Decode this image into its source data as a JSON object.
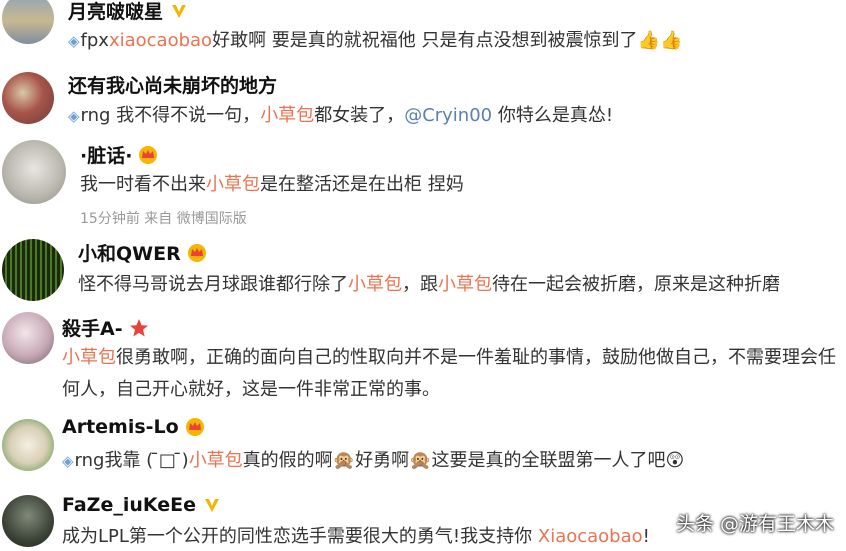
{
  "comments": [
    {
      "user": "月亮啵啵星",
      "badge": "gold-v",
      "segments": [
        {
          "t": "gem"
        },
        {
          "t": "text",
          "v": "fpx"
        },
        {
          "t": "link",
          "v": "xiaocaobao"
        },
        {
          "t": "text",
          "v": "好敢啊 要是真的就祝福他 只是有点没想到被震惊到了"
        },
        {
          "t": "emoji",
          "v": "👍👍"
        }
      ]
    },
    {
      "user": "还有我心尚未崩坏的地方",
      "badge": "",
      "segments": [
        {
          "t": "gem"
        },
        {
          "t": "text",
          "v": "rng 我不得不说一句，"
        },
        {
          "t": "link",
          "v": "小草包"
        },
        {
          "t": "text",
          "v": "都女装了，"
        },
        {
          "t": "blue",
          "v": "@Cryin00"
        },
        {
          "t": "text",
          "v": " 你特么是真怂!"
        }
      ]
    },
    {
      "user": "·脏话·",
      "badge": "crown",
      "segments": [
        {
          "t": "text",
          "v": "我一时看不出来"
        },
        {
          "t": "link",
          "v": "小草包"
        },
        {
          "t": "text",
          "v": "是在整活还是在出柜 捏妈"
        }
      ],
      "meta": "15分钟前  来自 微博国际版"
    },
    {
      "user": "小和QWER",
      "badge": "crown",
      "segments": [
        {
          "t": "text",
          "v": "怪不得马哥说去月球跟谁都行除了"
        },
        {
          "t": "link",
          "v": "小草包"
        },
        {
          "t": "text",
          "v": "，跟"
        },
        {
          "t": "link",
          "v": "小草包"
        },
        {
          "t": "text",
          "v": "待在一起会被折磨，原来是这种折磨"
        }
      ]
    },
    {
      "user": "殺手A-",
      "badge": "star",
      "segments": [
        {
          "t": "link",
          "v": "小草包"
        },
        {
          "t": "text",
          "v": "很勇敢啊，正确的面向自己的性取向并不是一件羞耻的事情，鼓励他做自己，不需要理会任何人，自己开心就好，这是一件非常正常的事。"
        }
      ]
    },
    {
      "user": "Artemis-Lo",
      "badge": "crown",
      "segments": [
        {
          "t": "gem"
        },
        {
          "t": "text",
          "v": "rng我靠 (  ̄□ ̄)"
        },
        {
          "t": "link",
          "v": "小草包"
        },
        {
          "t": "text",
          "v": "真的假的啊"
        },
        {
          "t": "emoji",
          "v": "🙊"
        },
        {
          "t": "text",
          "v": "好勇啊"
        },
        {
          "t": "emoji",
          "v": "🙊"
        },
        {
          "t": "text",
          "v": "这要是真的全联盟第一人了吧"
        },
        {
          "t": "emoji",
          "v": "😲"
        }
      ]
    },
    {
      "user": "FaZe_iuKeEe",
      "badge": "gold-v",
      "segments": [
        {
          "t": "text",
          "v": "成为LPL第一个公开的同性恋选手需要很大的勇气!我支持你 "
        },
        {
          "t": "link",
          "v": "Xiaocaobao"
        },
        {
          "t": "text",
          "v": "!"
        }
      ]
    }
  ],
  "watermark": "头条 @游有王木木"
}
